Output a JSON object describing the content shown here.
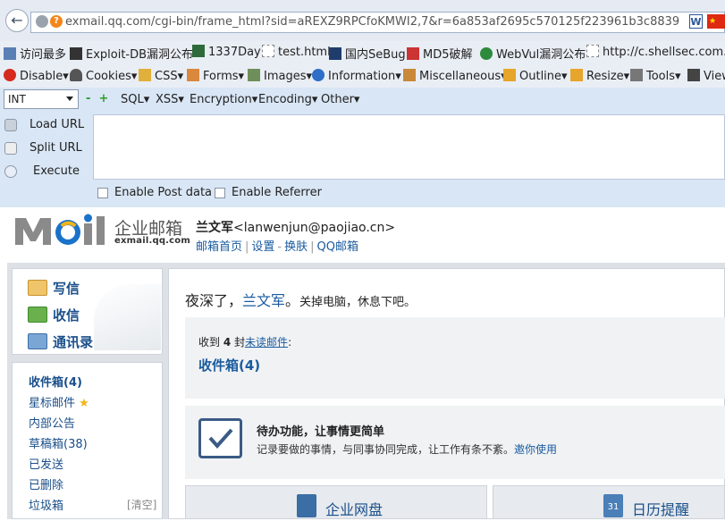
{
  "browser": {
    "url": "exmail.qq.com/cgi-bin/frame_html?sid=aREXZ9RPCfoKMWI2,7&r=6a853af2695c570125f223961b3c8839",
    "bookmarks": [
      "访问最多",
      "Exploit-DB漏洞公布",
      "1337Day",
      "test.html",
      "国内SeBug",
      "MD5破解",
      "WebVul漏洞公布",
      "http://c.shellsec.com..."
    ],
    "webdev_toolbar": [
      "Disable",
      "Cookies",
      "CSS",
      "Forms",
      "Images",
      "Information",
      "Miscellaneous",
      "Outline",
      "Resize",
      "Tools",
      "View"
    ]
  },
  "hackbar": {
    "type_select": "INT",
    "menu": [
      "SQL",
      "XSS",
      "Encryption",
      "Encoding",
      "Other"
    ],
    "load_url": "Load URL",
    "split_url": "Split URL",
    "execute": "Execute",
    "enable_post": "Enable Post data",
    "enable_referrer": "Enable Referrer"
  },
  "mail": {
    "brand_cn": "企业邮箱",
    "brand_domain": "exmail.qq.com",
    "user_name": "兰文军",
    "user_email": "<lanwenjun@paojiao.cn>",
    "links": [
      "邮箱首页",
      "设置",
      "换肤",
      "QQ邮箱"
    ],
    "actions": [
      "写信",
      "收信",
      "通讯录"
    ],
    "folders": [
      "收件箱(4)",
      "星标邮件",
      "内部公告",
      "草稿箱(38)",
      "已发送",
      "已删除",
      "垃圾箱"
    ],
    "clear_label": "[清空]",
    "greeting_prefix": "夜深了，",
    "greeting_name": "兰文军",
    "greeting_suffix": "。",
    "greeting_tail": "关掉电脑，休息下吧。",
    "received_prefix": "收到",
    "received_count": "4",
    "received_unit": "封",
    "received_link": "未读邮件",
    "received_suffix": ":",
    "inbox_link": "收件箱(4)",
    "todo_title": "待办功能，让事情更简单",
    "todo_desc": "记录要做的事情，与同事协同完成，让工作有条不紊。",
    "todo_link": "邀你使用",
    "tile_disk": "企业网盘",
    "tile_calendar": "日历提醒",
    "calendar_day": "31"
  },
  "colors": {
    "link": "#1a5b9e",
    "accent_blue": "#1a73c9",
    "hackbar_bg": "#d9e6f5"
  }
}
